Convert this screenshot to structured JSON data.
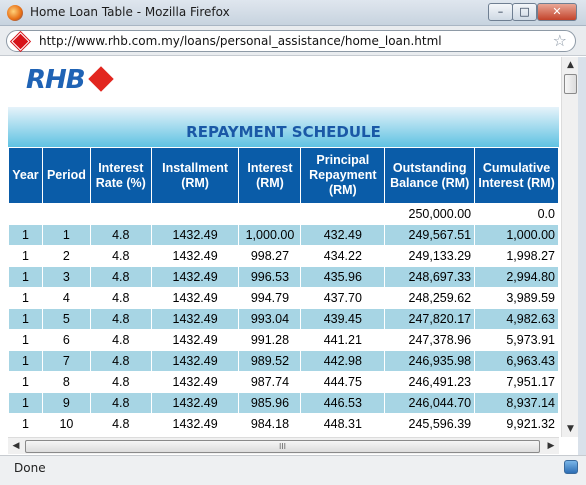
{
  "window": {
    "title": "Home Loan Table - Mozilla Firefox",
    "min_glyph": "–",
    "max_glyph": "□",
    "close_glyph": "✕"
  },
  "urlbar": {
    "url": "http://www.rhb.com.my/loans/personal_assistance/home_loan.html",
    "star_glyph": "☆"
  },
  "page": {
    "logo_text": "RHB",
    "schedule_title": "REPAYMENT SCHEDULE",
    "columns": [
      "Year",
      "Period",
      "Interest Rate (%)",
      "Installment (RM)",
      "Interest (RM)",
      "Principal Repayment (RM)",
      "Outstanding Balance (RM)",
      "Cumulative Interest (RM)"
    ],
    "starting_row": {
      "outstanding": "250,000.00",
      "cumulative": "0.0"
    },
    "rows": [
      [
        "1",
        "1",
        "4.8",
        "1432.49",
        "1,000.00",
        "432.49",
        "249,567.51",
        "1,000.00"
      ],
      [
        "1",
        "2",
        "4.8",
        "1432.49",
        "998.27",
        "434.22",
        "249,133.29",
        "1,998.27"
      ],
      [
        "1",
        "3",
        "4.8",
        "1432.49",
        "996.53",
        "435.96",
        "248,697.33",
        "2,994.80"
      ],
      [
        "1",
        "4",
        "4.8",
        "1432.49",
        "994.79",
        "437.70",
        "248,259.62",
        "3,989.59"
      ],
      [
        "1",
        "5",
        "4.8",
        "1432.49",
        "993.04",
        "439.45",
        "247,820.17",
        "4,982.63"
      ],
      [
        "1",
        "6",
        "4.8",
        "1432.49",
        "991.28",
        "441.21",
        "247,378.96",
        "5,973.91"
      ],
      [
        "1",
        "7",
        "4.8",
        "1432.49",
        "989.52",
        "442.98",
        "246,935.98",
        "6,963.43"
      ],
      [
        "1",
        "8",
        "4.8",
        "1432.49",
        "987.74",
        "444.75",
        "246,491.23",
        "7,951.17"
      ],
      [
        "1",
        "9",
        "4.8",
        "1432.49",
        "985.96",
        "446.53",
        "246,044.70",
        "8,937.14"
      ],
      [
        "1",
        "10",
        "4.8",
        "1432.49",
        "984.18",
        "448.31",
        "245,596.39",
        "9,921.32"
      ]
    ]
  },
  "scrollbars": {
    "up_glyph": "▲",
    "down_glyph": "▼",
    "left_glyph": "◀",
    "right_glyph": "▶",
    "grip_glyph": "III"
  },
  "status": {
    "text": "Done"
  },
  "colors": {
    "header_blue": "#0a5ca8",
    "row_blue": "#a7d5e4",
    "title_blue": "#1a58a6",
    "logo_red": "#e2261f"
  },
  "icons": {
    "firefox": "firefox-icon",
    "site": "site-favicon-icon",
    "bookmark": "star-icon",
    "status": "status-icon"
  }
}
